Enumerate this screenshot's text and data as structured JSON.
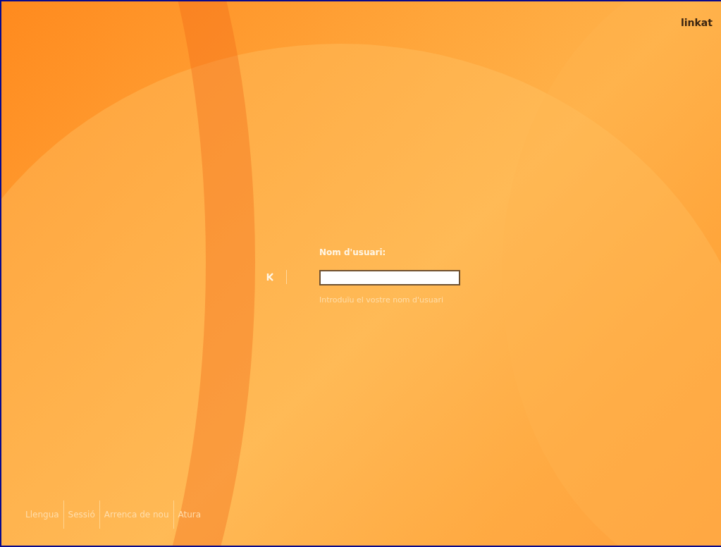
{
  "logo": {
    "text": "linkat"
  },
  "login": {
    "label": "Nom d'usuari:",
    "hint": "Introduïu el vostre nom d'usuari"
  },
  "footer": [
    {
      "label": "Llengua"
    },
    {
      "label": "Sessió"
    },
    {
      "label": "Arrenca de nou"
    },
    {
      "label": "Atura"
    }
  ]
}
